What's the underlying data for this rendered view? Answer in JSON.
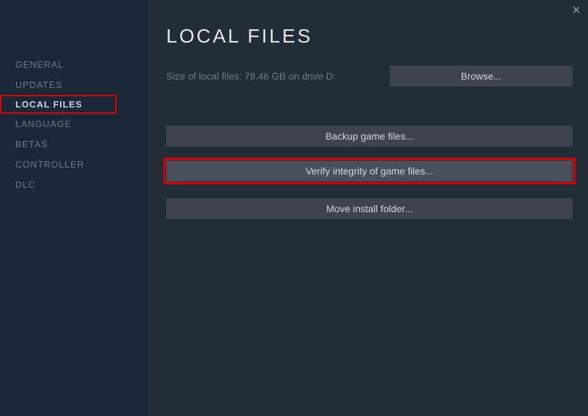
{
  "sidebar": {
    "items": [
      {
        "label": "GENERAL",
        "active": false,
        "highlight": false
      },
      {
        "label": "UPDATES",
        "active": false,
        "highlight": false
      },
      {
        "label": "LOCAL FILES",
        "active": true,
        "highlight": true
      },
      {
        "label": "LANGUAGE",
        "active": false,
        "highlight": false
      },
      {
        "label": "BETAS",
        "active": false,
        "highlight": false
      },
      {
        "label": "CONTROLLER",
        "active": false,
        "highlight": false
      },
      {
        "label": "DLC",
        "active": false,
        "highlight": false
      }
    ]
  },
  "panel": {
    "title": "LOCAL FILES",
    "size_text": "Size of local files: 78.46 GB on drive D:",
    "browse_button": "Browse...",
    "backup_button": "Backup game files...",
    "verify_button": "Verify integrity of game files...",
    "move_button": "Move install folder..."
  },
  "close_icon": "✕"
}
